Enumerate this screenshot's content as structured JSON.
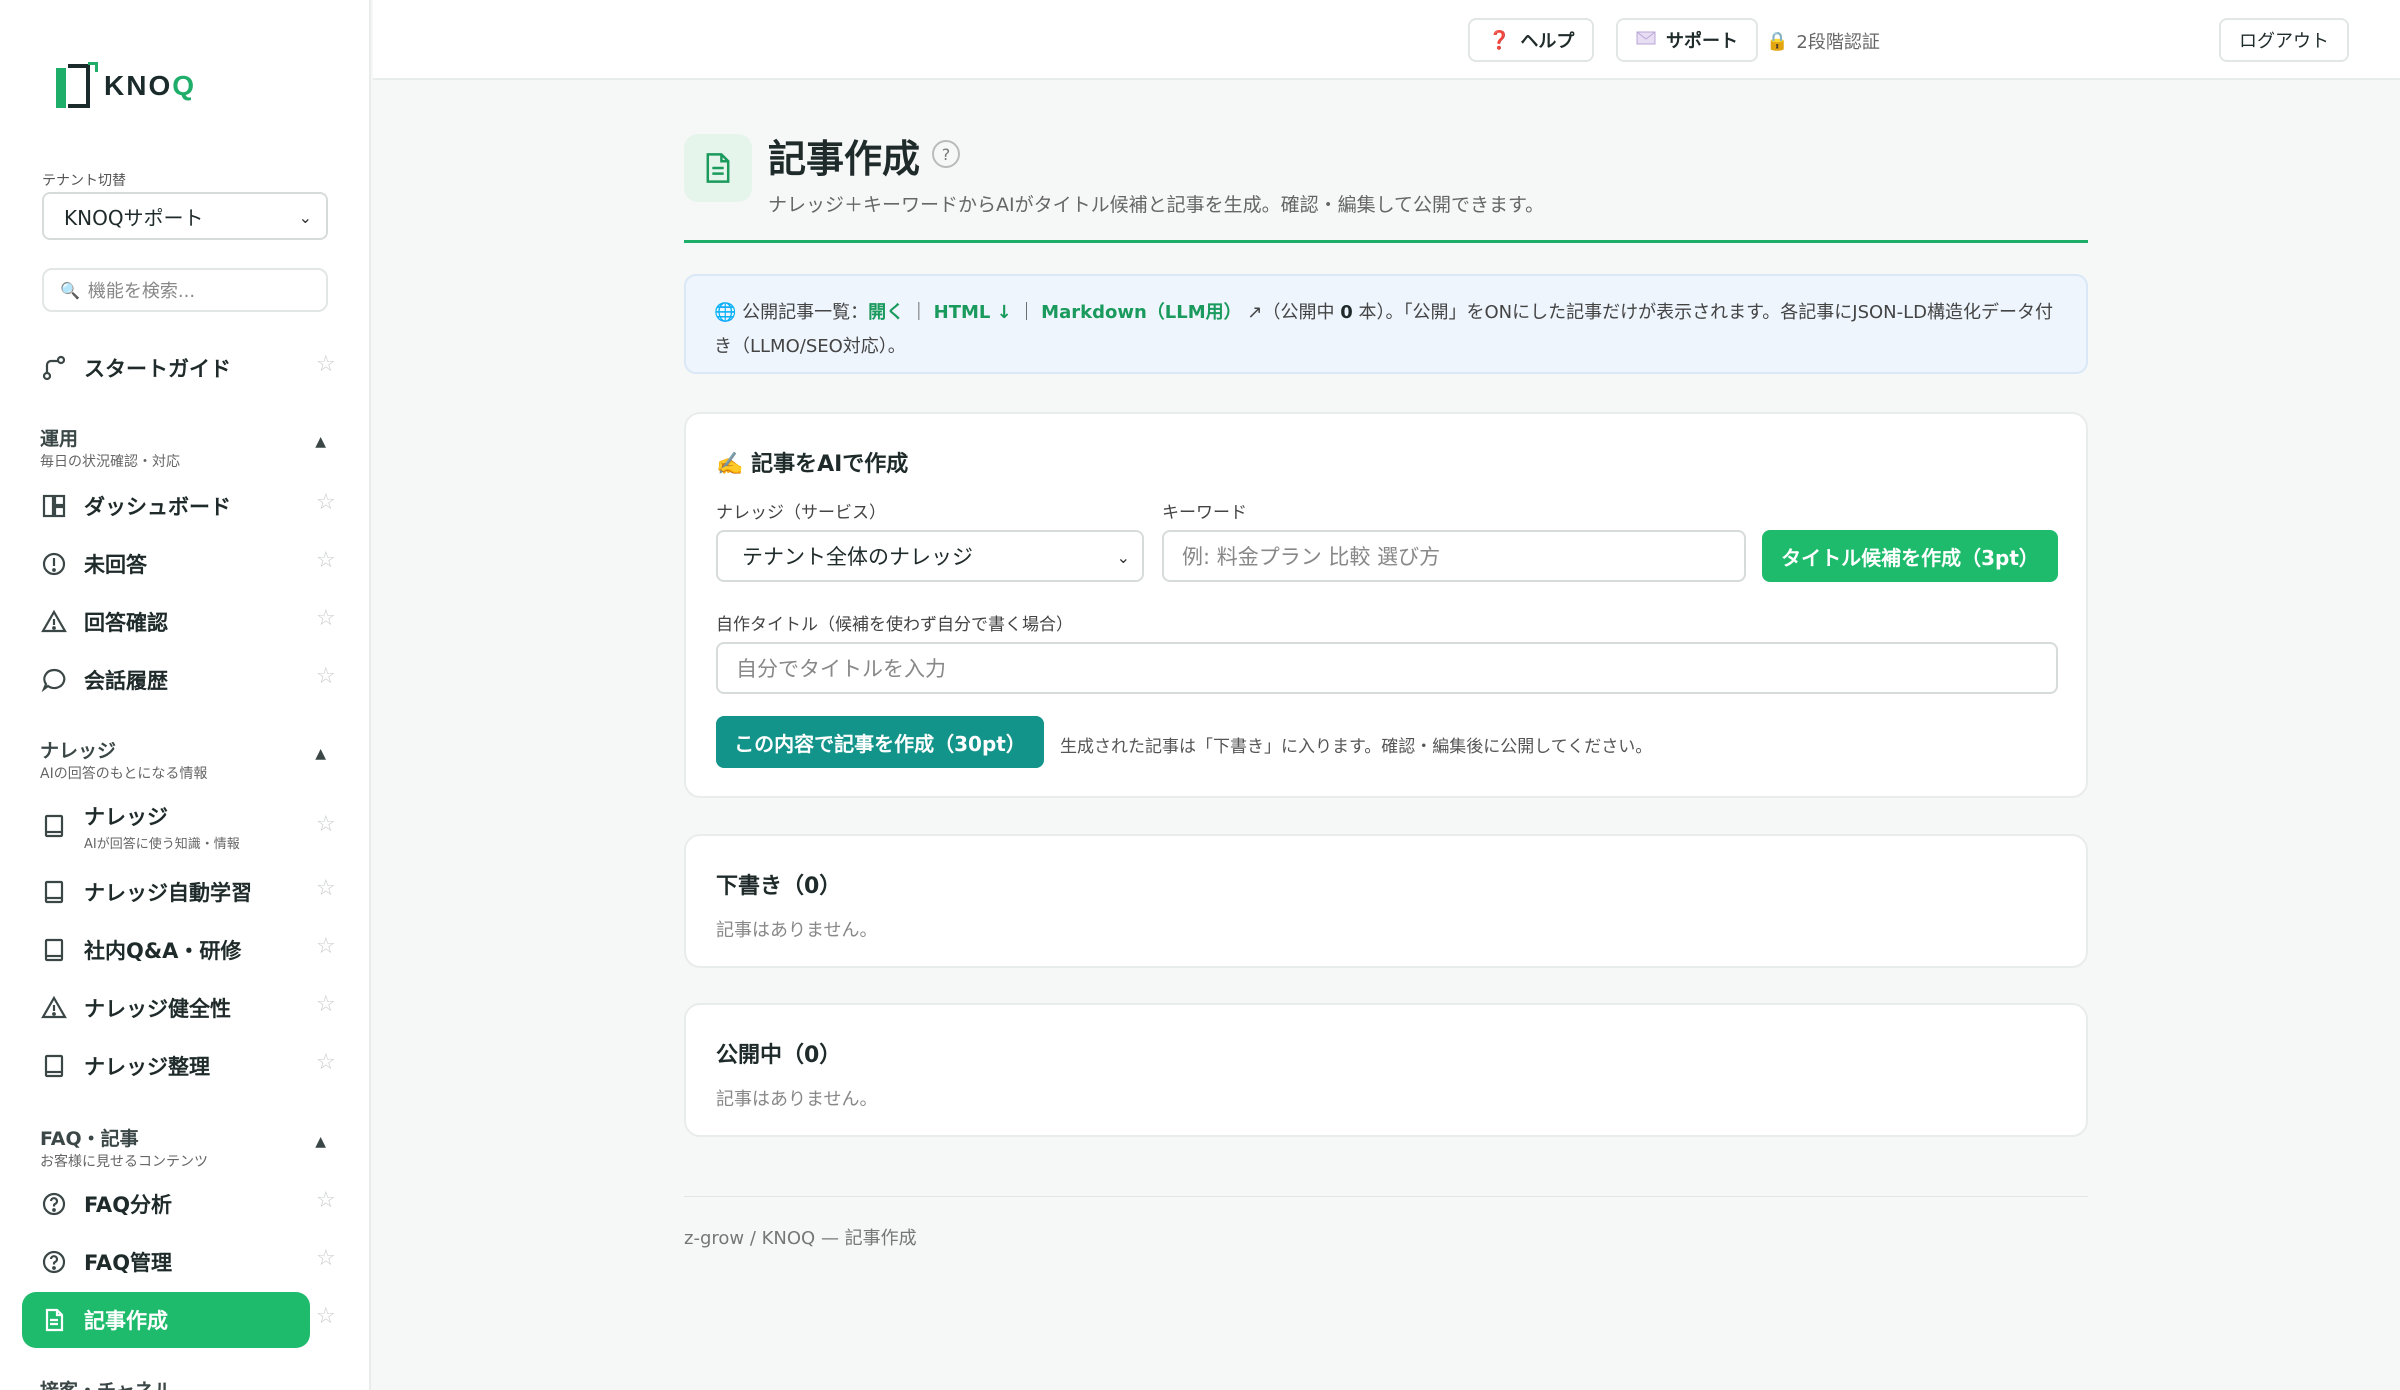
{
  "logo": {
    "text_main": "KNO",
    "text_accent": "Q"
  },
  "sidebar": {
    "tenant_label": "テナント切替",
    "tenant_value": "KNOQサポート",
    "search_placeholder": "機能を検索...",
    "start_guide": "スタートガイド",
    "sections": [
      {
        "title": "運用",
        "subtitle": "毎日の状況確認・対応"
      },
      {
        "title": "ナレッジ",
        "subtitle": "AIの回答のもとになる情報"
      },
      {
        "title": "FAQ・記事",
        "subtitle": "お客様に見せるコンテンツ"
      },
      {
        "title": "接客・チャネル"
      }
    ],
    "items": [
      {
        "label": "ダッシュボード"
      },
      {
        "label": "未回答"
      },
      {
        "label": "回答確認"
      },
      {
        "label": "会話履歴"
      },
      {
        "label": "ナレッジ",
        "sub": "AIが回答に使う知識・情報"
      },
      {
        "label": "ナレッジ自動学習"
      },
      {
        "label": "社内Q&A・研修"
      },
      {
        "label": "ナレッジ健全性"
      },
      {
        "label": "ナレッジ整理"
      },
      {
        "label": "FAQ分析"
      },
      {
        "label": "FAQ管理"
      },
      {
        "label": "記事作成"
      }
    ],
    "star": "☆"
  },
  "topbar": {
    "help": "ヘルプ",
    "support": "サポート",
    "two_factor": "2段階認証",
    "logout": "ログアウト"
  },
  "main": {
    "title": "記事作成",
    "help_mark": "?",
    "description": "ナレッジ＋キーワードからAIがタイトル候補と記事を生成。確認・編集して公開できます。",
    "info": {
      "prefix": "公開記事一覧：",
      "open": "開く",
      "sep1": "｜",
      "html": "HTML ↓",
      "sep2": "｜",
      "markdown": "Markdown（LLM用）",
      "arrow": "↗",
      "count_open": "（公開中 ",
      "count": "0",
      "count_close": " 本）。",
      "note": "「公開」をONにした記事だけが表示されます。各記事にJSON-LD構造化データ付き（LLMO/SEO対応）。"
    },
    "ai_card": {
      "emoji": "✍️",
      "title": "記事をAIで作成",
      "knowledge_label": "ナレッジ（サービス）",
      "knowledge_value": "テナント全体のナレッジ",
      "keyword_label": "キーワード",
      "keyword_placeholder": "例: 料金プラン 比較 選び方",
      "title_candidates_button": "タイトル候補を作成（3pt）",
      "custom_title_label": "自作タイトル（候補を使わず自分で書く場合）",
      "custom_title_placeholder": "自分でタイトルを入力",
      "create_button": "この内容で記事を作成（30pt）",
      "create_hint": "生成された記事は「下書き」に入ります。確認・編集後に公開してください。"
    },
    "drafts": {
      "title": "下書き（0）",
      "empty": "記事はありません。"
    },
    "published": {
      "title": "公開中（0）",
      "empty": "記事はありません。"
    },
    "footer": "z-grow / KNOQ — 記事作成"
  }
}
